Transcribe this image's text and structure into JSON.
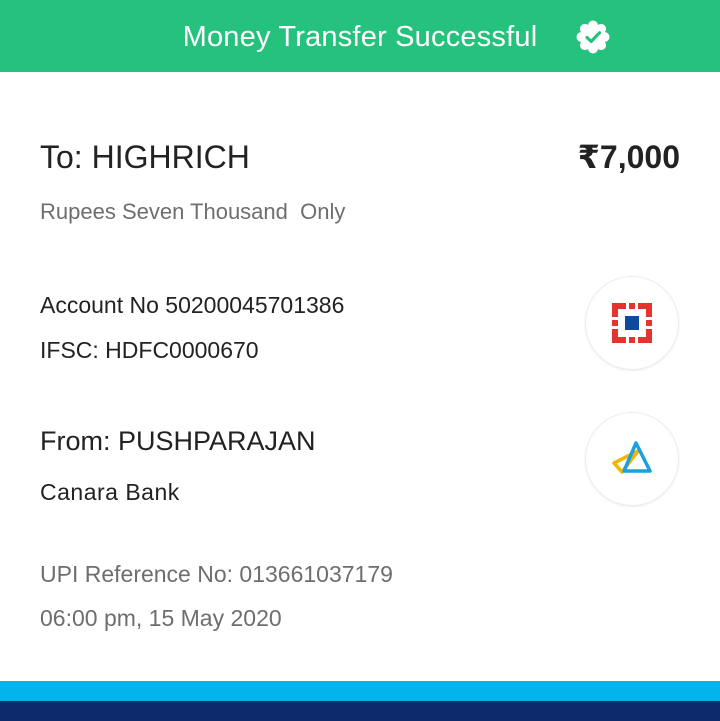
{
  "header": {
    "title": "Money Transfer Successful",
    "badge_icon": "verified-check-badge-icon",
    "background_color": "#25c27d"
  },
  "recipient": {
    "to_label": "To: HIGHRICH",
    "amount": "₹7,000",
    "amount_in_words": "Rupees Seven Thousand  Only",
    "account_no": "Account No 50200045701386",
    "ifsc": "IFSC: HDFC0000670",
    "bank_logo_icon": "hdfc-bank-logo-icon"
  },
  "sender": {
    "from_label": "From: PUSHPARAJAN",
    "bank_name": "Canara Bank",
    "bank_logo_icon": "canara-bank-logo-icon"
  },
  "transaction": {
    "upi_reference": "UPI Reference No: 013661037179",
    "timestamp": "06:00 pm, 15 May 2020"
  },
  "colors": {
    "success_green": "#25c27d",
    "hdfc_red": "#e3342f",
    "hdfc_blue": "#0d4a9c",
    "footer_light_blue": "#03b4ec",
    "footer_dark_blue": "#0d2b6b"
  }
}
